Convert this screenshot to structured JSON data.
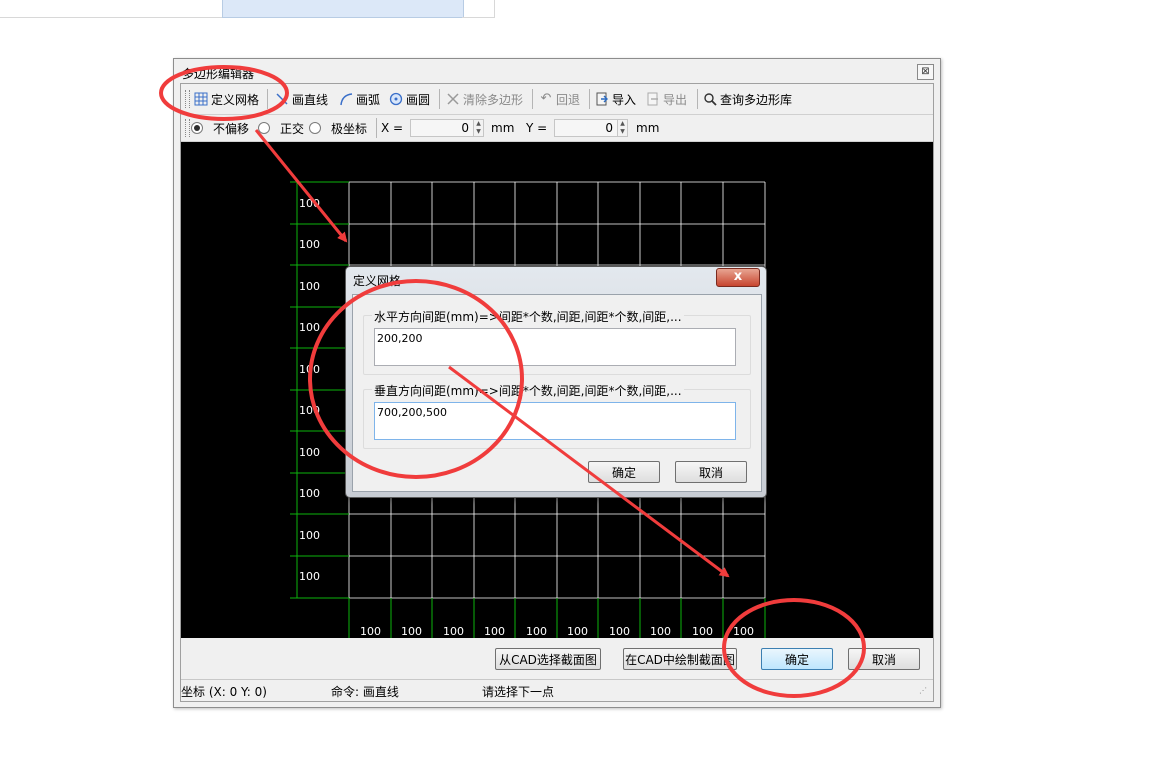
{
  "main_window": {
    "title": "多边形编辑器",
    "close_glyph": "⊠",
    "toolbar": {
      "define_grid": "定义网格",
      "draw_line": "画直线",
      "draw_arc": "画弧",
      "draw_circle": "画圆",
      "clear_polygon": "清除多边形",
      "undo": "回退",
      "import": "导入",
      "export": "导出",
      "query_library": "查询多边形库"
    },
    "options": {
      "no_offset": "不偏移",
      "orthogonal": "正交",
      "polar": "极坐标",
      "x_label": "X =",
      "x_value": "0",
      "x_unit": "mm",
      "y_label": "Y =",
      "y_value": "0",
      "y_unit": "mm"
    },
    "canvas": {
      "row_labels": [
        "100",
        "100",
        "100",
        "100",
        "100",
        "100",
        "100",
        "100",
        "100",
        "100"
      ],
      "col_labels": [
        "100",
        "100",
        "100",
        "100",
        "100",
        "100",
        "100",
        "100",
        "100",
        "100"
      ]
    },
    "buttons": {
      "from_cad": "从CAD选择截面图",
      "draw_in_cad": "在CAD中绘制截面图",
      "ok": "确定",
      "cancel": "取消"
    },
    "status": {
      "coords": "坐标 (X: 0 Y: 0)",
      "command": "命令: 画直线",
      "prompt": "请选择下一点"
    }
  },
  "dialog": {
    "title": "定义网格",
    "close_glyph": "x",
    "horizontal_label": "水平方向间距(mm)=>间距*个数,间距,间距*个数,间距,...",
    "horizontal_value": "200,200",
    "vertical_label": "垂直方向间距(mm)=>间距*个数,间距,间距*个数,间距,...",
    "vertical_value": "700,200,500",
    "ok": "确定",
    "cancel": "取消"
  },
  "colors": {
    "annotation_red": "#f03c3c",
    "grid_white": "#ffffff",
    "axis_green": "#0db30d"
  }
}
